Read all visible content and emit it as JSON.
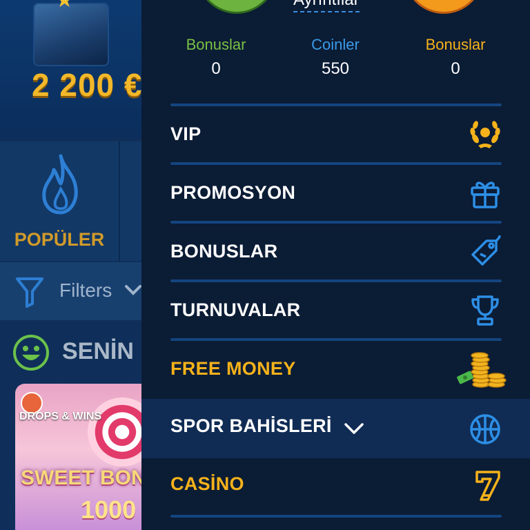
{
  "background": {
    "banner": {
      "amount": "2 200 €"
    },
    "category": {
      "label": "POPÜLER",
      "icon": "flame-icon"
    },
    "filters": {
      "label": "Filters"
    },
    "section": {
      "title": "SENİN"
    },
    "game_tile": {
      "badge": "DROPS & WINS",
      "title": "SWEET BON",
      "amount": "1000"
    }
  },
  "drawer": {
    "details_link": "Ayrıntılar",
    "stats": [
      {
        "label": "Bonuslar",
        "value": "0",
        "color": "#7ac143"
      },
      {
        "label": "Coinler",
        "value": "550",
        "color": "#3a9be8"
      },
      {
        "label": "Bonuslar",
        "value": "0",
        "color": "#f6b21a"
      }
    ],
    "menu_items": [
      {
        "label": "VIP",
        "icon": "laurel-wreath-icon"
      },
      {
        "label": "PROMOSYON",
        "icon": "gift-icon"
      },
      {
        "label": "BONUSLAR",
        "icon": "tag-icon"
      },
      {
        "label": "TURNUVALAR",
        "icon": "trophy-icon"
      },
      {
        "label": "FREE MONEY",
        "icon": "coin-stack-icon"
      }
    ],
    "sport": {
      "label": "SPOR BAHİSLERİ",
      "icon": "basketball-icon"
    },
    "casino": {
      "label": "CASİNO",
      "icon": "slot-seven-icon"
    }
  },
  "colors": {
    "drawer_bg": "#0b1c35",
    "accent_gold": "#f6b21a",
    "accent_blue": "#3a9be8",
    "accent_green": "#7ac143",
    "separator": "#14457f"
  }
}
